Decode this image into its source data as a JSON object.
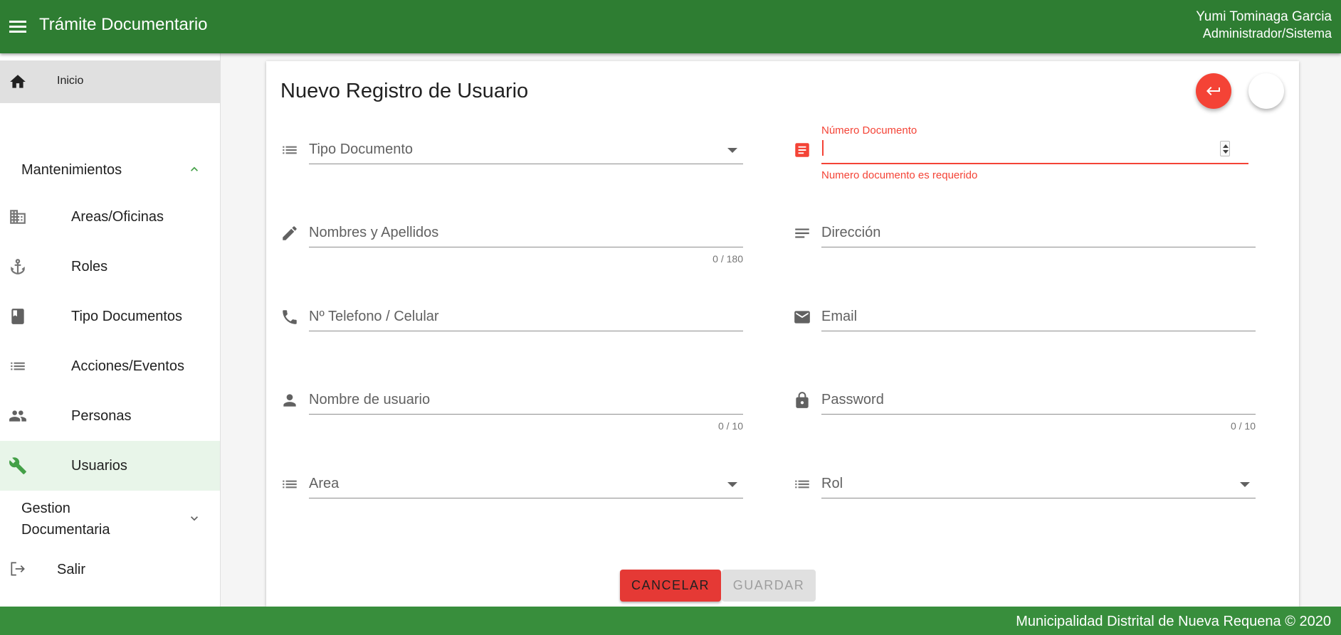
{
  "header": {
    "title": "Trámite Documentario",
    "user_name": "Yumi Tominaga Garcia",
    "user_role": "Administrador/Sistema"
  },
  "sidebar": {
    "home": "Inicio",
    "group_mantenimientos": "Mantenimientos",
    "items": [
      {
        "label": "Areas/Oficinas",
        "icon": "building-icon"
      },
      {
        "label": "Roles",
        "icon": "anchor-icon"
      },
      {
        "label": "Tipo Documentos",
        "icon": "book-icon"
      },
      {
        "label": "Acciones/Eventos",
        "icon": "list-icon"
      },
      {
        "label": "Personas",
        "icon": "people-icon"
      },
      {
        "label": "Usuarios",
        "icon": "wrench-icon",
        "active": true
      }
    ],
    "group_gestion_line1": "Gestion",
    "group_gestion_line2": "Documentaria",
    "logout": "Salir"
  },
  "form": {
    "title": "Nuevo Registro de Usuario",
    "tipo_documento": "Tipo Documento",
    "numero_documento_label": "Número Documento",
    "numero_documento_error": "Numero documento es requerido",
    "nombres": "Nombres y Apellidos",
    "nombres_counter": "0 / 180",
    "direccion": "Dirección",
    "telefono": "Nº Telefono / Celular",
    "email": "Email",
    "usuario": "Nombre de usuario",
    "usuario_counter": "0 / 10",
    "password": "Password",
    "password_counter": "0 / 10",
    "area": "Area",
    "rol": "Rol",
    "cancel_label": "CANCELAR",
    "save_label": "GUARDAR"
  },
  "footer": {
    "text": "Municipalidad Distrital de Nueva Requena © 2020"
  },
  "colors": {
    "header": "#2e7d32",
    "footer": "#388e3c",
    "error": "#f44336",
    "active_item_bg": "#e8f5e9",
    "accent_green": "#43a047"
  }
}
